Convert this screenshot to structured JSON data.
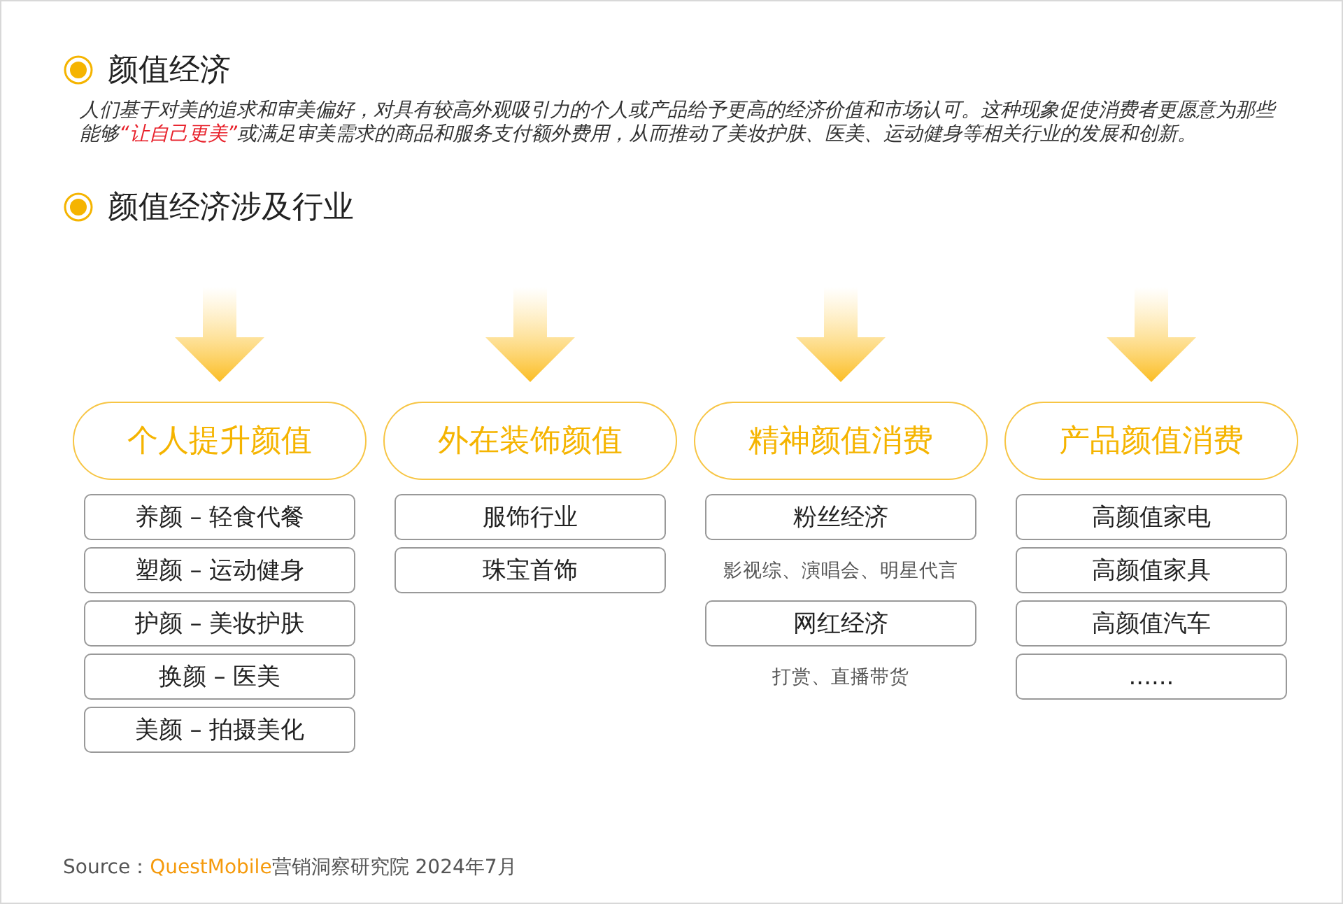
{
  "section_1": {
    "title": "颜值经济",
    "paragraph": [
      {
        "text": "人们基于对美的追求和审美偏好，对具有较高外观吸引力的个人或产品给予更高的经济价值和市场认可。这种现象促使消费者更愿意为那些能够",
        "highlight": false
      },
      {
        "text": "“让自己更美”",
        "highlight": true
      },
      {
        "text": "或满足审美需求的商品和服务支付额外费用，从而推动了美妆护肤、医美、运动健身等相关行业的发展和创新。",
        "highlight": false
      }
    ]
  },
  "section_2": {
    "title": "颜值经济涉及行业",
    "columns": [
      {
        "heading": "个人提升颜值",
        "items": [
          {
            "kind": "box",
            "text": "养颜 – 轻食代餐"
          },
          {
            "kind": "box",
            "text": "塑颜 – 运动健身"
          },
          {
            "kind": "box",
            "text": "护颜 – 美妆护肤"
          },
          {
            "kind": "box",
            "text": "换颜 – 医美"
          },
          {
            "kind": "box",
            "text": "美颜 – 拍摄美化"
          }
        ]
      },
      {
        "heading": "外在装饰颜值",
        "items": [
          {
            "kind": "box",
            "text": "服饰行业"
          },
          {
            "kind": "box",
            "text": "珠宝首饰"
          }
        ]
      },
      {
        "heading": "精神颜值消费",
        "items": [
          {
            "kind": "box",
            "text": "粉丝经济"
          },
          {
            "kind": "note",
            "text": "影视综、演唱会、明星代言"
          },
          {
            "kind": "box",
            "text": "网红经济"
          },
          {
            "kind": "note",
            "text": "打赏、直播带货"
          }
        ]
      },
      {
        "heading": "产品颜值消费",
        "items": [
          {
            "kind": "box",
            "text": "高颜值家电"
          },
          {
            "kind": "box",
            "text": "高颜值家具"
          },
          {
            "kind": "box",
            "text": "高颜值汽车"
          },
          {
            "kind": "box",
            "text": "......"
          }
        ]
      }
    ]
  },
  "source": [
    {
      "text": "Source：",
      "highlight": false
    },
    {
      "text": "QuestMobile",
      "highlight": true
    },
    {
      "text": "营销洞察研究院 2024年7月",
      "highlight": false
    }
  ]
}
